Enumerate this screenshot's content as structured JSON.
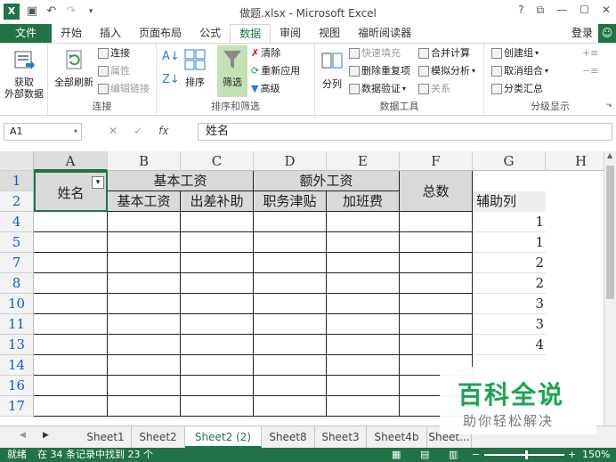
{
  "titlebar": {
    "title": "做题.xlsx - Microsoft Excel",
    "help": "?",
    "restore": "⧉",
    "minimize": "—",
    "maximize": "☐",
    "close": "✕"
  },
  "tabs": [
    "文件",
    "开始",
    "插入",
    "页面布局",
    "公式",
    "数据",
    "审阅",
    "视图",
    "福昕阅读器"
  ],
  "active_tab": "数据",
  "login": "登录",
  "ribbon": {
    "get_external": "获取\n外部数据",
    "refresh_all": "全部刷新",
    "connections": "连接",
    "properties": "属性",
    "edit_links": "编辑链接",
    "group_connections": "连接",
    "sort": "排序",
    "filter": "筛选",
    "clear": "清除",
    "reapply": "重新应用",
    "advanced": "高级",
    "group_sortfilter": "排序和筛选",
    "text_to_columns": "分列",
    "flash_fill": "快速填充",
    "remove_duplicates": "删除重复项",
    "data_validation": "数据验证",
    "consolidate": "合并计算",
    "what_if": "模拟分析",
    "relationships": "关系",
    "group_datatools": "数据工具",
    "group": "创建组",
    "ungroup": "取消组合",
    "subtotal": "分类汇总",
    "group_outline": "分级显示"
  },
  "formula_bar": {
    "name_box": "A1",
    "cancel": "✕",
    "enter": "✓",
    "fx": "fx",
    "content": "姓名"
  },
  "columns": [
    "A",
    "B",
    "C",
    "D",
    "E",
    "F",
    "G",
    "H"
  ],
  "rows": [
    "1",
    "2",
    "4",
    "5",
    "7",
    "8",
    "10",
    "11",
    "13",
    "14",
    "16",
    "17"
  ],
  "headers": {
    "name": "姓名",
    "basic_wage": "基本工资",
    "extra_wage": "额外工资",
    "total": "总数",
    "sub_basic": "基本工资",
    "sub_travel": "出差补助",
    "sub_duty": "职务津贴",
    "sub_overtime": "加班费",
    "helper": "辅助列"
  },
  "helper_values": [
    "1",
    "1",
    "2",
    "2",
    "3",
    "3",
    "4"
  ],
  "sheet_tabs": [
    "Sheet1",
    "Sheet2",
    "Sheet2 (2)",
    "Sheet8",
    "Sheet3",
    "Sheet4b",
    "Sheet..."
  ],
  "active_sheet": "Sheet2 (2)",
  "status": {
    "mode": "就绪",
    "message": "在 34 条记录中找到 23 个",
    "zoom": "150%"
  },
  "watermark": {
    "title": "百科全说",
    "subtitle": "助你轻松解决"
  }
}
